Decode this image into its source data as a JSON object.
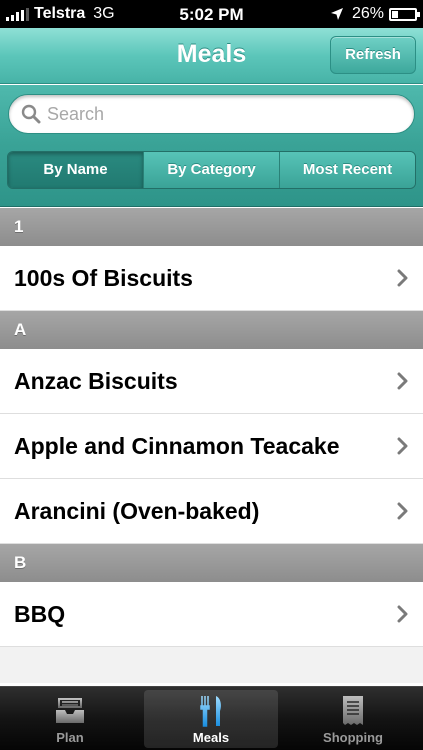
{
  "status_bar": {
    "carrier": "Telstra",
    "network": "3G",
    "time": "5:02 PM",
    "battery_percent": "26%",
    "battery_level": 0.26
  },
  "nav": {
    "title": "Meals",
    "refresh_label": "Refresh"
  },
  "search": {
    "placeholder": "Search",
    "value": ""
  },
  "segments": [
    {
      "label": "By Name",
      "selected": true
    },
    {
      "label": "By Category",
      "selected": false
    },
    {
      "label": "Most Recent",
      "selected": false
    }
  ],
  "sections": [
    {
      "header": "1",
      "items": [
        "100s Of Biscuits"
      ]
    },
    {
      "header": "A",
      "items": [
        "Anzac Biscuits",
        "Apple and Cinnamon Teacake",
        "Arancini (Oven-baked)"
      ]
    },
    {
      "header": "B",
      "items": [
        "BBQ"
      ]
    }
  ],
  "tabs": [
    {
      "label": "Plan",
      "icon": "inbox-tray-icon",
      "selected": false
    },
    {
      "label": "Meals",
      "icon": "fork-knife-icon",
      "selected": true
    },
    {
      "label": "Shopping",
      "icon": "receipt-icon",
      "selected": false
    }
  ],
  "colors": {
    "accent": "#4fb9ad",
    "tab_selected": "#3ba8e8"
  }
}
